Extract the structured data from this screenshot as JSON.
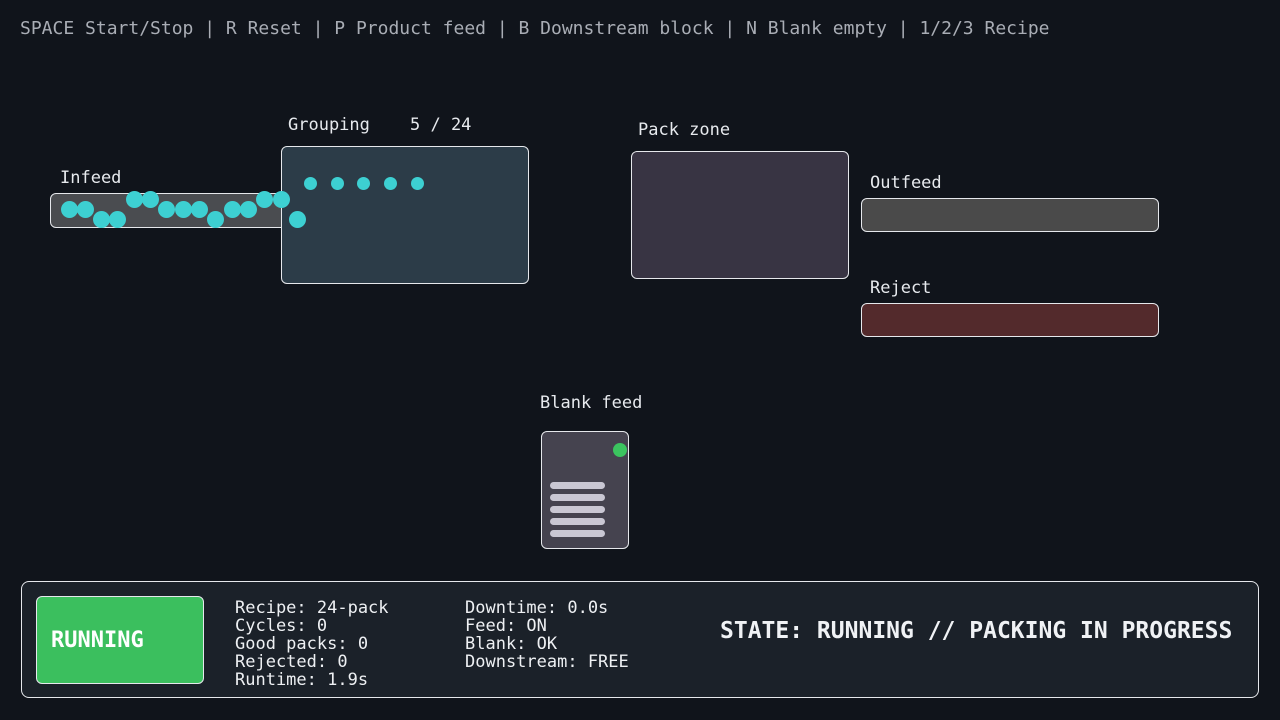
{
  "help_text": "SPACE Start/Stop | R Reset | P Product feed | B Downstream block | N Blank empty | 1/2/3 Recipe",
  "zones": {
    "infeed_label": "Infeed",
    "grouping_label": "Grouping",
    "grouping_count": "5 / 24",
    "pack_zone_label": "Pack zone",
    "outfeed_label": "Outfeed",
    "reject_label": "Reject",
    "blank_feed_label": "Blank feed"
  },
  "status_button_label": "RUNNING",
  "stats_left": {
    "recipe": "Recipe: 24-pack",
    "cycles": "Cycles: 0",
    "good_packs": "Good packs: 0",
    "rejected": "Rejected: 0",
    "runtime": "Runtime: 1.9s"
  },
  "stats_right": {
    "downtime": "Downtime: 0.0s",
    "feed": "Feed: ON",
    "blank": "Blank: OK",
    "downstream": "Downstream: FREE"
  },
  "state_line": "STATE: RUNNING // PACKING IN PROGRESS",
  "colors": {
    "background": "#10141b",
    "product": "#3dd0d2",
    "running_green": "#3bbf5e",
    "blank_ok_indicator": "#3bc45f",
    "reject_lane": "#532a2c"
  }
}
